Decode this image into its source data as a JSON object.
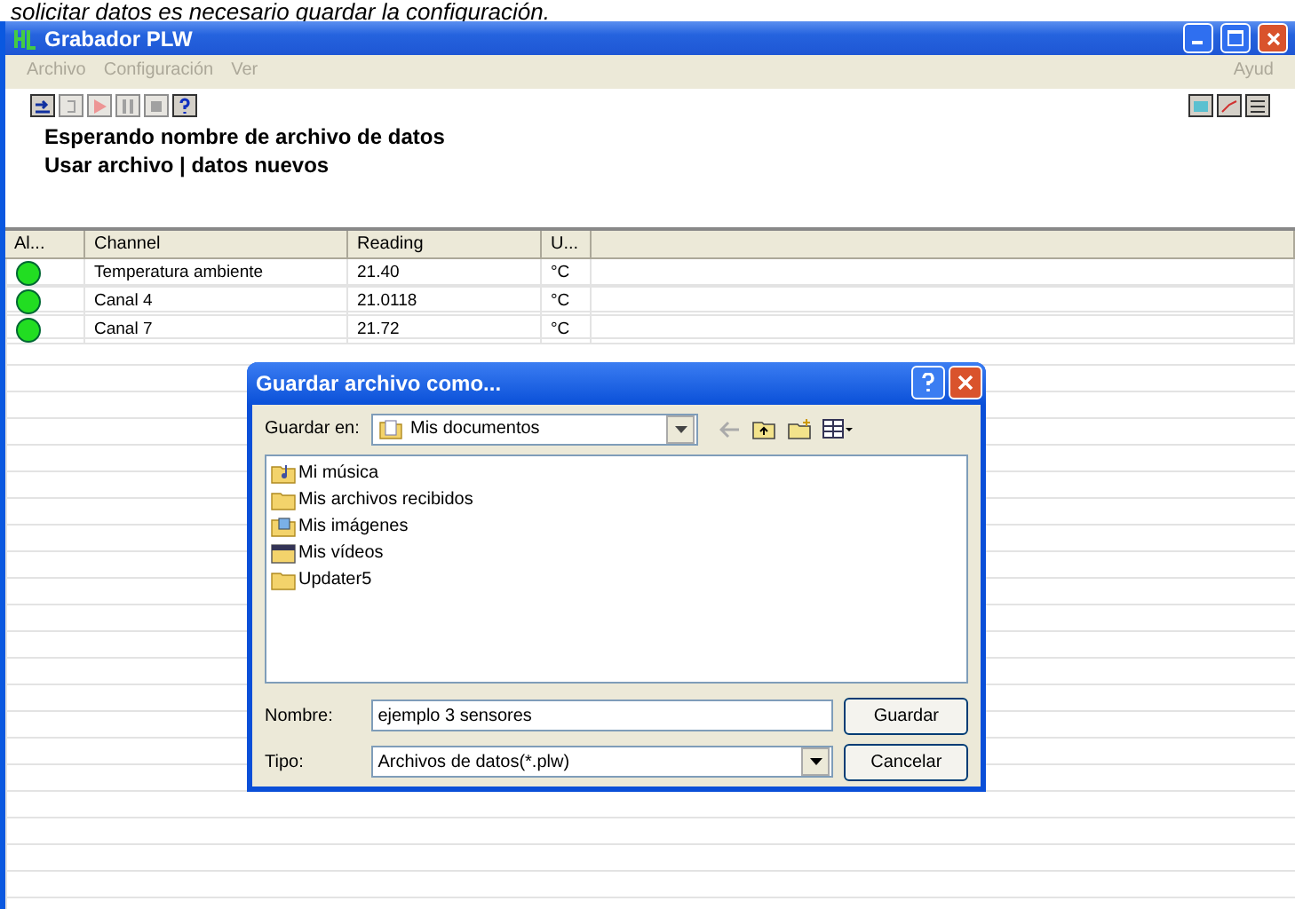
{
  "caption": "solicitar datos es necesario guardar la configuración.",
  "window": {
    "title": "Grabador PLW"
  },
  "menu": [
    {
      "label": "Archivo",
      "disabled": true
    },
    {
      "label": "Configuración",
      "disabled": true
    },
    {
      "label": "Ver",
      "disabled": true
    }
  ],
  "menu_right": {
    "label": "Ayud",
    "disabled": true
  },
  "toolbar": [
    {
      "kind": "start",
      "disabled": false
    },
    {
      "kind": "repeat",
      "disabled": true
    },
    {
      "kind": "record",
      "disabled": true
    },
    {
      "kind": "pause",
      "disabled": true
    },
    {
      "kind": "stop",
      "disabled": true
    },
    {
      "kind": "help",
      "disabled": false
    }
  ],
  "toolbar_right": [
    {
      "kind": "notes"
    },
    {
      "kind": "graph"
    },
    {
      "kind": "list"
    }
  ],
  "status_lines": [
    "Esperando nombre de archivo de datos",
    "Usar archivo | datos nuevos"
  ],
  "table": {
    "columns": [
      "Al...",
      "Channel",
      "Reading",
      "U..."
    ],
    "rows": [
      {
        "color": "#22dd22",
        "channel": "Temperatura ambiente",
        "reading": "21.40",
        "unit": "°C"
      },
      {
        "color": "#22dd22",
        "channel": "Canal 4",
        "reading": "21.0118",
        "unit": "°C"
      },
      {
        "color": "#22dd22",
        "channel": "Canal 7",
        "reading": "21.72",
        "unit": "°C"
      }
    ]
  },
  "dialog": {
    "title": "Guardar archivo como...",
    "save_in": {
      "label": "Guardar en:",
      "value": "Mis documentos"
    },
    "files": [
      {
        "name": "Mi música",
        "kind": "music"
      },
      {
        "name": "Mis archivos recibidos",
        "kind": "folder"
      },
      {
        "name": "Mis imágenes",
        "kind": "pictures"
      },
      {
        "name": "Mis vídeos",
        "kind": "video"
      },
      {
        "name": "Updater5",
        "kind": "folder"
      }
    ],
    "file_name": {
      "label": "Nombre:",
      "value": "ejemplo 3 sensores"
    },
    "file_type": {
      "label": "Tipo:",
      "value": "Archivos de datos(*.plw)"
    },
    "buttons": [
      "Guardar",
      "Cancelar"
    ]
  }
}
